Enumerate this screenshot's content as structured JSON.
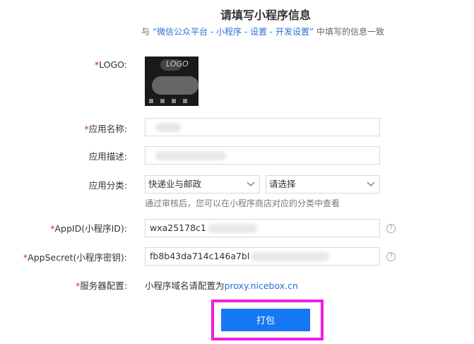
{
  "header": {
    "title": "请填写小程序信息",
    "subtitle_prefix": "与",
    "subtitle_path": "“微信公众平台 - 小程序 - 设置 - 开发设置”",
    "subtitle_suffix": "中填写的信息一致"
  },
  "form": {
    "logo_label": "LOGO:",
    "logo_text": "LOGO",
    "app_name_label": "应用名称:",
    "app_desc_label": "应用描述:",
    "category_label": "应用分类:",
    "category_value": "快递业与邮政",
    "subcategory_value": "请选择",
    "category_hint": "通过审核后，您可以在小程序商店对应的分类中查看",
    "appid_label": "AppID(小程序ID):",
    "appid_value": "wxa25178c1",
    "appsecret_label": "AppSecret(小程序密钥):",
    "appsecret_value": "fb8b43da714c146a7bl",
    "server_label": "服务器配置:",
    "server_text": "小程序域名请配置为",
    "server_domain": "proxy.nicebox.cn",
    "required_mark": "*",
    "help_glyph": "?"
  },
  "actions": {
    "pack_label": "打包"
  },
  "colors": {
    "accent": "#1677f5",
    "highlight": "#ee1fe0",
    "required": "#e0231b",
    "link": "#2a6fd6"
  }
}
